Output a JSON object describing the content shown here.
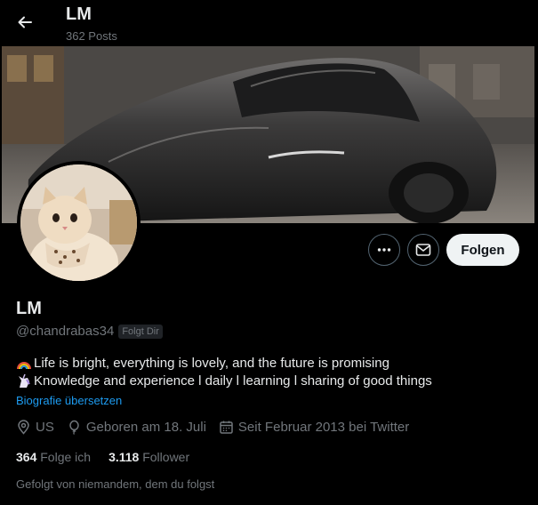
{
  "header": {
    "title": "LM",
    "posts_count": "362 Posts"
  },
  "actions": {
    "follow_label": "Folgen"
  },
  "profile": {
    "name": "LM",
    "handle": "@chandrabas34",
    "follows_you_badge": "Folgt Dir",
    "bio_lines": [
      "Life is bright, everything is lovely, and the future is promising",
      "Knowledge and experience l daily l learning l sharing of good things"
    ],
    "translate_link": "Biografie übersetzen",
    "location": "US",
    "birthday": "Geboren am 18. Juli",
    "joined": "Seit Februar 2013 bei Twitter",
    "following_count": "364",
    "following_label": "Folge ich",
    "followers_count": "3.118",
    "followers_label": "Follower",
    "followed_by": "Gefolgt von niemandem, dem du folgst"
  },
  "icons": {
    "back": "arrow-left-icon",
    "more": "more-horizontal-icon",
    "message": "envelope-icon",
    "location": "map-pin-icon",
    "birthday": "balloon-icon",
    "joined": "calendar-icon"
  },
  "colors": {
    "background": "#000000",
    "text_primary": "#e7e9ea",
    "text_secondary": "#71767b",
    "link": "#1d9bf0",
    "follow_button": "#eff3f4"
  }
}
